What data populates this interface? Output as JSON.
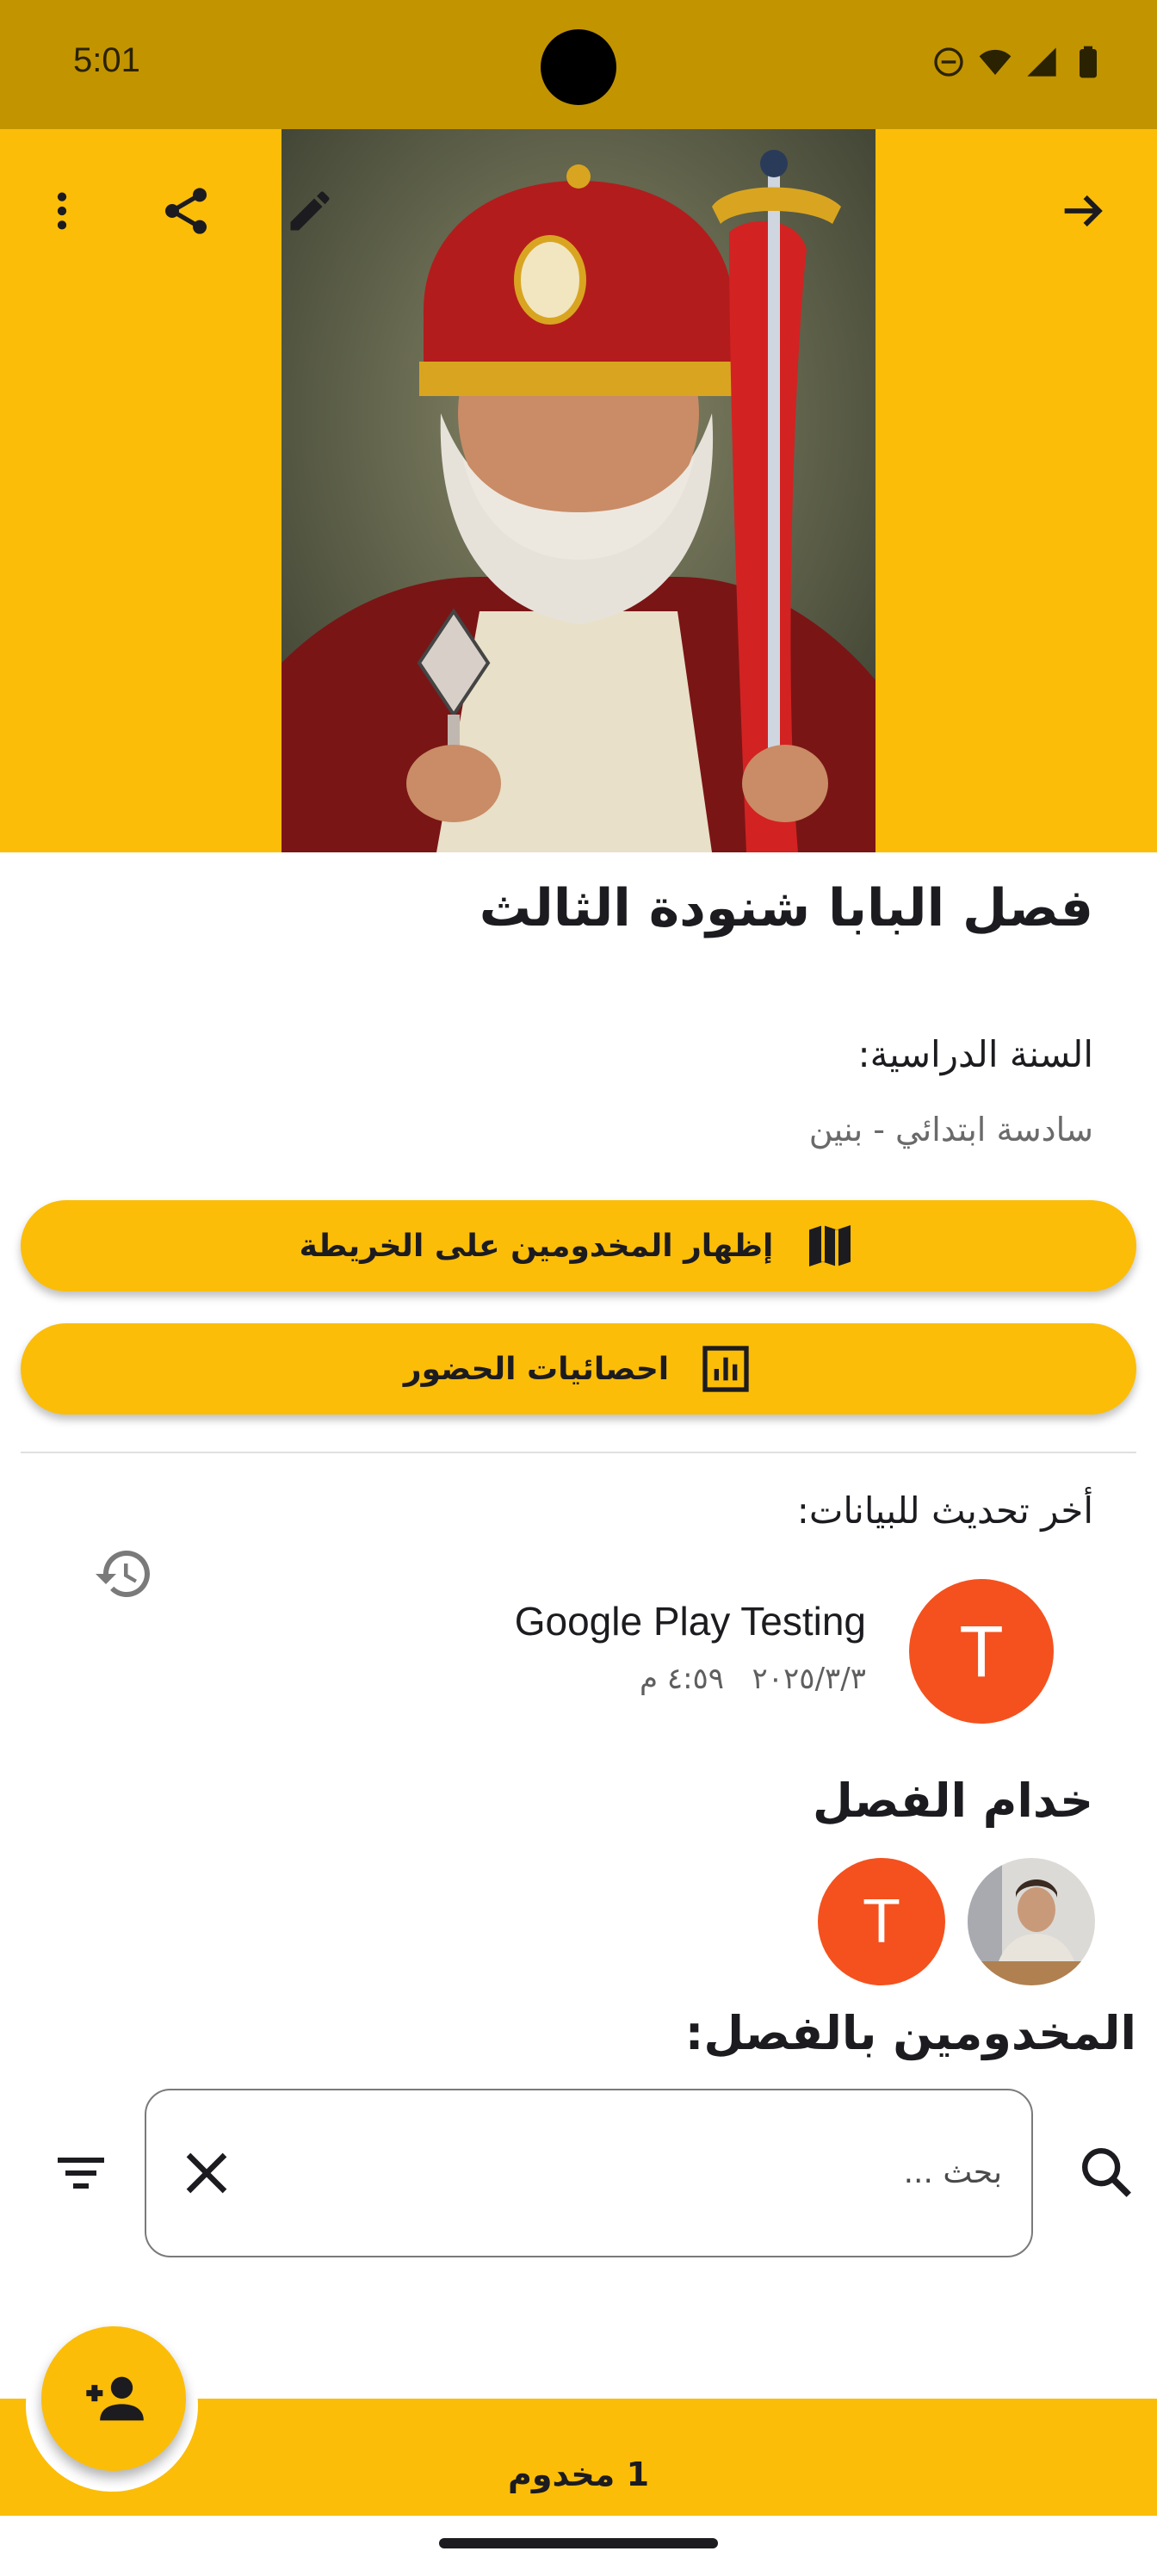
{
  "status_bar": {
    "time": "5:01"
  },
  "header": {
    "image_alt": "Pope Shenouda III",
    "icons": [
      "more-vert-icon",
      "share-icon",
      "edit-icon",
      "arrow-forward-icon"
    ]
  },
  "class_info": {
    "title": "فصل البابا شنودة الثالث",
    "study_year_label": "السنة الدراسية:",
    "study_year_value": "سادسة ابتدائي - بنين"
  },
  "actions": {
    "map_label": "إظهار المخدومين على الخريطة",
    "stats_label": "احصائيات الحضور"
  },
  "last_update": {
    "label": "أخر تحديث للبيانات:",
    "user_initial": "T",
    "user_name": "Google Play Testing",
    "date": "٢٠٢٥/٣/٣",
    "time": "٤:٥٩ م"
  },
  "servants": {
    "title": "خدام الفصل",
    "avatar_initial": "T"
  },
  "served": {
    "title": "المخدومين بالفصل:",
    "search_placeholder": "بحث ..."
  },
  "bottom": {
    "count_label": "1 مخدوم"
  },
  "colors": {
    "primary": "#fbbd08",
    "status_bar": "#c29400",
    "avatar": "#f4511e"
  }
}
